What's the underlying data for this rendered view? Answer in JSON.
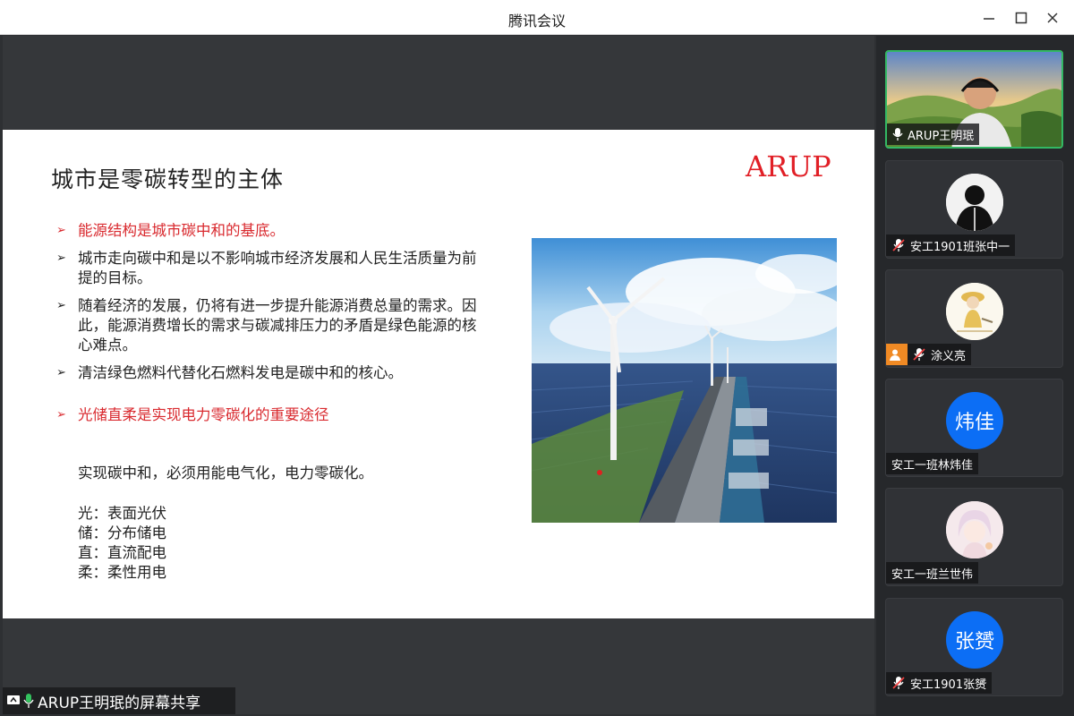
{
  "window": {
    "title": "腾讯会议"
  },
  "slide": {
    "title": "城市是零碳转型的主体",
    "logo": "ARUP",
    "bullets": [
      {
        "text": "能源结构是城市碳中和的基底。",
        "highlight": true
      },
      {
        "text": "城市走向碳中和是以不影响城市经济发展和人民生活质量为前提的目标。",
        "highlight": false
      },
      {
        "text": "随着经济的发展，仍将有进一步提升能源消费总量的需求。因此，能源消费增长的需求与碳减排压力的矛盾是绿色能源的核心难点。",
        "highlight": false
      },
      {
        "text": "清洁绿色燃料代替化石燃料发电是碳中和的核心。",
        "highlight": false
      },
      {
        "text": "光储直柔是实现电力零碳化的重要途径",
        "highlight": true
      }
    ],
    "summary": "实现碳中和，必须用能电气化，电力零碳化。",
    "definitions": [
      "光：表面光伏",
      "储：分布储电",
      "直：直流配电",
      "柔：柔性用电"
    ]
  },
  "screen_share": {
    "label": "ARUP王明珉的屏幕共享"
  },
  "participants": [
    {
      "name": "ARUP王明珉",
      "muted": false,
      "avatar_text": "",
      "kind": "video"
    },
    {
      "name": "安工1901班张中一",
      "muted": true,
      "avatar_text": "",
      "kind": "photo-dark"
    },
    {
      "name": "涂义亮",
      "muted": true,
      "avatar_text": "",
      "kind": "photo-cartoon"
    },
    {
      "name": "安工一班林炜佳",
      "muted": false,
      "avatar_text": "炜佳",
      "kind": "initials"
    },
    {
      "name": "安工一班兰世伟",
      "muted": false,
      "avatar_text": "",
      "kind": "photo-anime"
    },
    {
      "name": "安工1901张赟",
      "muted": true,
      "avatar_text": "张赟",
      "kind": "initials"
    }
  ],
  "colors": {
    "accent_red": "#d92a2f",
    "logo_red": "#e11f26",
    "avatar_blue": "#0c6ef5",
    "active_border": "#33b864"
  }
}
